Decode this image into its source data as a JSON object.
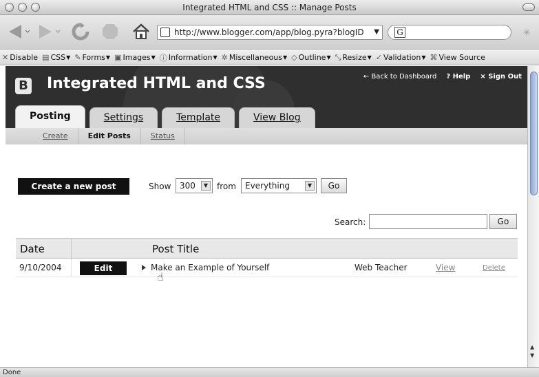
{
  "window": {
    "title": "Integrated HTML and CSS :: Manage Posts"
  },
  "browser": {
    "url": "http://www.blogger.com/app/blog.pyra?blogID",
    "search_value": "",
    "status": "Done",
    "devbar": [
      {
        "icon": "disable-icon",
        "label": "Disable"
      },
      {
        "icon": "css-icon",
        "label": "CSS"
      },
      {
        "icon": "forms-icon",
        "label": "Forms"
      },
      {
        "icon": "images-icon",
        "label": "Images"
      },
      {
        "icon": "information-icon",
        "label": "Information"
      },
      {
        "icon": "miscellaneous-icon",
        "label": "Miscellaneous"
      },
      {
        "icon": "outline-icon",
        "label": "Outline"
      },
      {
        "icon": "resize-icon",
        "label": "Resize"
      },
      {
        "icon": "validation-icon",
        "label": "Validation"
      },
      {
        "icon": "view-source-icon",
        "label": "View Source"
      }
    ]
  },
  "blog": {
    "title": "Integrated HTML and CSS",
    "toplinks": {
      "back": "← Back to Dashboard",
      "help": "? Help",
      "signout": "× Sign Out"
    },
    "tabs": [
      "Posting",
      "Settings",
      "Template",
      "View Blog"
    ],
    "active_tab": "Posting",
    "subnav": [
      "Create",
      "Edit Posts",
      "Status"
    ],
    "active_subnav": "Edit Posts"
  },
  "controls": {
    "new_post": "Create a new post",
    "show_label": "Show",
    "show_value": "300",
    "from_label": "from",
    "from_value": "Everything",
    "go": "Go",
    "search_label": "Search:",
    "search_value": "",
    "search_go": "Go"
  },
  "table": {
    "headers": {
      "date": "Date",
      "title": "Post Title"
    },
    "rows": [
      {
        "date": "9/10/2004",
        "edit": "Edit",
        "title": "Make an Example of Yourself",
        "author": "Web Teacher",
        "view": "View",
        "delete": "Delete"
      }
    ]
  },
  "colors": {
    "header_bg": "#2f2f2f",
    "button_bg": "#111111",
    "scroll_thumb": "#8ea9cf"
  }
}
